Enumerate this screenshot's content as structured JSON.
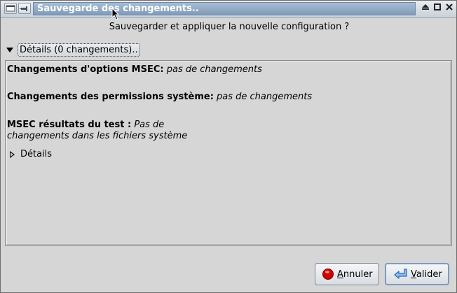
{
  "window": {
    "title": "Sauvegarde des changements..",
    "menu_icon": "window-menu-icon",
    "pin_icon": "pin-icon",
    "shade_icon": "shade-icon",
    "maximize_icon": "maximize-icon",
    "close_icon": "close-icon"
  },
  "dialog": {
    "question": "Sauvegarder et appliquer la nouvelle configuration ?",
    "details_expander": {
      "label": "Détails (0 changements)..",
      "icon": "expander-expanded-icon",
      "expanded": true
    },
    "sections": [
      {
        "heading": "Changements d'options MSEC:",
        "value": "pas de changements"
      },
      {
        "heading": "Changements des permissions système:",
        "value": "pas de changements"
      },
      {
        "heading": "MSEC résultats du test :",
        "value_line1": "Pas de",
        "value_line2": "changements dans les fichiers système"
      }
    ],
    "sub_expander": {
      "label": "Détails",
      "icon": "expander-collapsed-icon",
      "expanded": false
    }
  },
  "buttons": {
    "cancel": {
      "label": "Annuler",
      "mnemonic": "A",
      "rest": "nnuler",
      "icon": "stop-icon"
    },
    "ok": {
      "label": "Valider",
      "mnemonic": "V",
      "rest": "alider",
      "icon": "enter-icon"
    }
  },
  "colors": {
    "window_bg": "#d6d6d6",
    "titlebar_active": "#7f9bba",
    "stop_icon": "#d10000",
    "enter_icon": "#3a7fd0"
  }
}
